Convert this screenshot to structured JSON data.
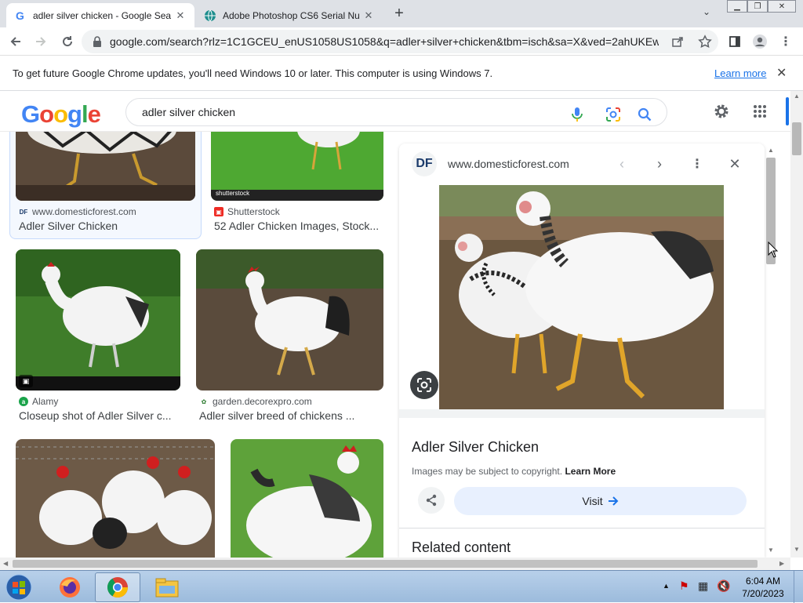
{
  "tabs": [
    {
      "title": "adler silver chicken - Google Sea",
      "favicon": "google-g-icon",
      "active": true
    },
    {
      "title": "Adobe Photoshop CS6 Serial Nu",
      "favicon": "globe-icon",
      "active": false
    }
  ],
  "toolbar": {
    "url": "google.com/search?rlz=1C1GCEU_enUS1058US1058&q=adler+silver+chicken&tbm=isch&sa=X&ved=2ahUKEw..."
  },
  "infobar": {
    "message": "To get future Google Chrome updates, you'll need Windows 10 or later. This computer is using Windows 7.",
    "link": "Learn more"
  },
  "google": {
    "logo_letters": [
      "G",
      "o",
      "o",
      "g",
      "l",
      "e"
    ],
    "query": "adler silver chicken"
  },
  "results": [
    {
      "source": "www.domesticforest.com",
      "caption": "Adler Silver Chicken",
      "fav_text": "DF"
    },
    {
      "source": "Shutterstock",
      "caption": "52 Adler Chicken Images, Stock...",
      "fav_text": "",
      "watermark": "shutterstock"
    },
    {
      "source": "Alamy",
      "caption": "Closeup shot of Adler Silver c...",
      "fav_text": "a"
    },
    {
      "source": "garden.decorexpro.com",
      "caption": "Adler silver breed of chickens ...",
      "fav_text": ""
    },
    {
      "source": "",
      "caption": ""
    },
    {
      "source": "",
      "caption": ""
    }
  ],
  "panel": {
    "site_badge": "DF",
    "site": "www.domesticforest.com",
    "title": "Adler Silver Chicken",
    "copyright_text": "Images may be subject to copyright.",
    "copyright_link": "Learn More",
    "visit_label": "Visit",
    "related_heading": "Related content"
  },
  "taskbar": {
    "time": "6:04 AM",
    "date": "7/20/2023"
  },
  "colors": {
    "google_blue": "#4285f4",
    "google_red": "#ea4335",
    "google_yellow": "#fbbc05",
    "google_green": "#34a853",
    "link_blue": "#1a73e8"
  }
}
